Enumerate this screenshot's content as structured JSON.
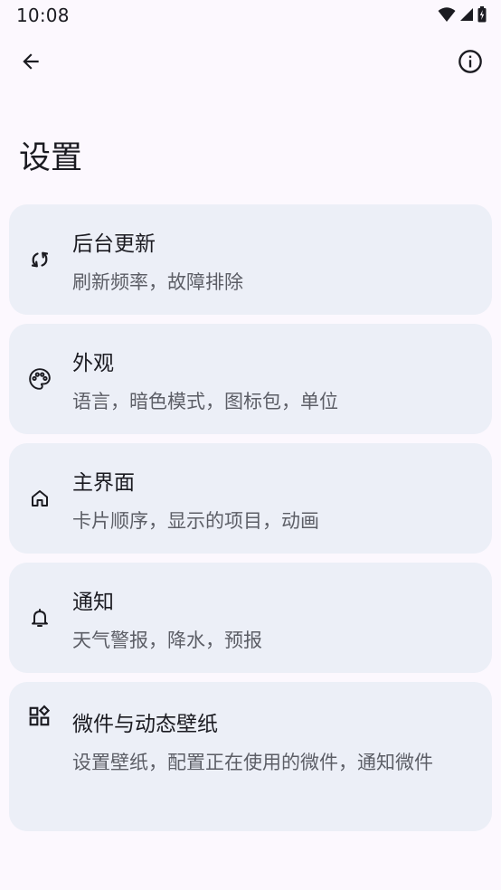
{
  "status_bar": {
    "time": "10:08",
    "icons": [
      "wifi-icon",
      "signal-icon",
      "battery-icon"
    ]
  },
  "app_bar": {
    "back_icon": "arrow-back-icon",
    "info_icon": "info-icon"
  },
  "page": {
    "title": "设置"
  },
  "settings": [
    {
      "icon": "sync-icon",
      "title": "后台更新",
      "subtitle": "刷新频率，故障排除"
    },
    {
      "icon": "palette-icon",
      "title": "外观",
      "subtitle": "语言，暗色模式，图标包，单位"
    },
    {
      "icon": "home-icon",
      "title": "主界面",
      "subtitle": "卡片顺序，显示的项目，动画"
    },
    {
      "icon": "bell-icon",
      "title": "通知",
      "subtitle": "天气警报，降水，预报"
    },
    {
      "icon": "widgets-icon",
      "title": "微件与动态壁纸",
      "subtitle": "设置壁纸，配置正在使用的微件，通知微件"
    }
  ],
  "colors": {
    "background": "#fcf8fe",
    "card": "#eceff7",
    "text_primary": "#1b1b21",
    "text_secondary": "#5c5e66"
  }
}
